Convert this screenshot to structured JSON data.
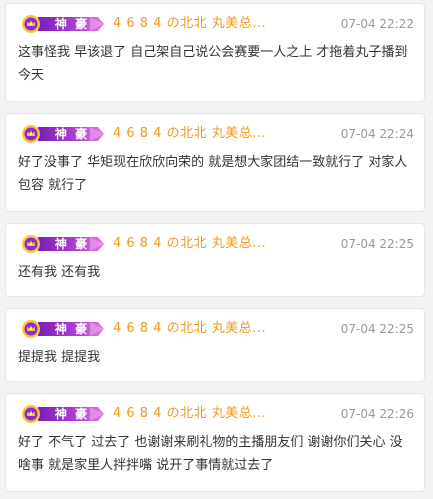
{
  "colors": {
    "background": "#f3f3f3",
    "card": "#ffffff",
    "username": "#f19a1f",
    "timestamp": "#999999",
    "message": "#333333",
    "badge_purple": "#8e2ac9",
    "badge_pink": "#d95bd6",
    "badge_gold": "#f5c542"
  },
  "comments": [
    {
      "badge_icon": "crown-emblem-icon",
      "badge_label": "神 豪",
      "username": "4 6 8 4 の北北 丸美总...",
      "time": "07-04 22:22",
      "text": "这事怪我 早该退了 自己架自己说公会赛要一人之上 才拖着丸子播到今天"
    },
    {
      "badge_icon": "crown-emblem-icon",
      "badge_label": "神 豪",
      "username": "4 6 8 4 の北北 丸美总...",
      "time": "07-04 22:24",
      "text": "好了没事了 华矩现在欣欣向荣的 就是想大家团结一致就行了 对家人包容 就行了"
    },
    {
      "badge_icon": "crown-emblem-icon",
      "badge_label": "神 豪",
      "username": "4 6 8 4 の北北 丸美总...",
      "time": "07-04 22:25",
      "text": "还有我 还有我"
    },
    {
      "badge_icon": "crown-emblem-icon",
      "badge_label": "神 豪",
      "username": "4 6 8 4 の北北 丸美总...",
      "time": "07-04 22:25",
      "text": "提提我 提提我"
    },
    {
      "badge_icon": "crown-emblem-icon",
      "badge_label": "神 豪",
      "username": "4 6 8 4 の北北 丸美总...",
      "time": "07-04 22:26",
      "text": "好了 不气了 过去了 也谢谢来刷礼物的主播朋友们 谢谢你们关心 没啥事 就是家里人拌拌嘴 说开了事情就过去了"
    }
  ]
}
